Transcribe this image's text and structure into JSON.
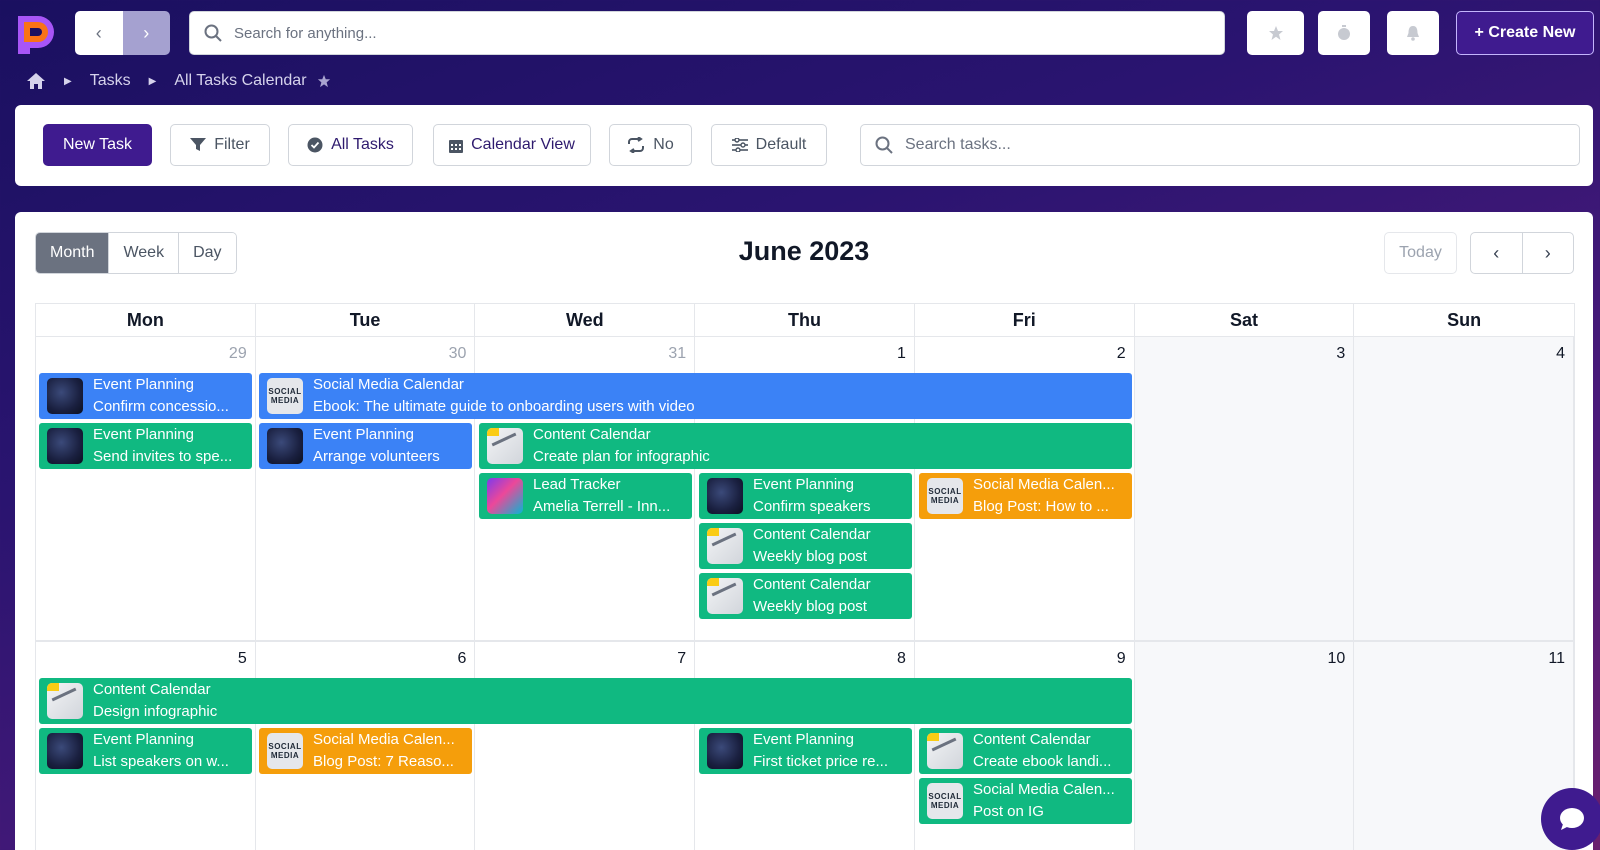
{
  "header": {
    "search_placeholder": "Search for anything...",
    "create_label": "+ Create New"
  },
  "breadcrumb": {
    "items": [
      "Tasks",
      "All Tasks Calendar"
    ]
  },
  "toolbar": {
    "new_task": "New Task",
    "filter": "Filter",
    "all_tasks": "All Tasks",
    "calendar_view": "Calendar View",
    "repeat": "No",
    "default": "Default",
    "search_placeholder": "Search tasks..."
  },
  "calendar": {
    "title": "June 2023",
    "views": [
      "Month",
      "Week",
      "Day"
    ],
    "active_view": "Month",
    "today_label": "Today",
    "weekdays": [
      "Mon",
      "Tue",
      "Wed",
      "Thu",
      "Fri",
      "Sat",
      "Sun"
    ],
    "weeks": [
      {
        "days": [
          "29",
          "30",
          "31",
          "1",
          "2",
          "3",
          "4"
        ],
        "muted": [
          true,
          true,
          true,
          false,
          false,
          false,
          false
        ]
      },
      {
        "days": [
          "5",
          "6",
          "7",
          "8",
          "9",
          "10",
          "11"
        ],
        "muted": [
          false,
          false,
          false,
          false,
          false,
          false,
          false
        ]
      }
    ],
    "events": [
      {
        "project": "Event Planning",
        "task": "Confirm concessio...",
        "color": "blue",
        "thumb": "space"
      },
      {
        "project": "Social Media Calendar",
        "task": "Ebook: The ultimate guide to onboarding users with video",
        "color": "blue",
        "thumb": "social"
      },
      {
        "project": "Event Planning",
        "task": "Send invites to spe...",
        "color": "green",
        "thumb": "space"
      },
      {
        "project": "Event Planning",
        "task": "Arrange volunteers",
        "color": "blue",
        "thumb": "space"
      },
      {
        "project": "Content Calendar",
        "task": "Create plan for infographic",
        "color": "green",
        "thumb": "content"
      },
      {
        "project": "Lead Tracker",
        "task": "Amelia Terrell - Inn...",
        "color": "green",
        "thumb": "lead"
      },
      {
        "project": "Event Planning",
        "task": "Confirm speakers",
        "color": "green",
        "thumb": "space"
      },
      {
        "project": "Social Media Calen...",
        "task": "Blog Post: How to ...",
        "color": "orange",
        "thumb": "social"
      },
      {
        "project": "Content Calendar",
        "task": "Weekly blog post",
        "color": "green",
        "thumb": "content"
      },
      {
        "project": "Content Calendar",
        "task": "Weekly blog post",
        "color": "green",
        "thumb": "content"
      },
      {
        "project": "Content Calendar",
        "task": "Design infographic",
        "color": "green",
        "thumb": "content"
      },
      {
        "project": "Event Planning",
        "task": "List speakers on w...",
        "color": "green",
        "thumb": "space"
      },
      {
        "project": "Social Media Calen...",
        "task": "Blog Post: 7 Reaso...",
        "color": "orange",
        "thumb": "social"
      },
      {
        "project": "Event Planning",
        "task": "First ticket price re...",
        "color": "green",
        "thumb": "space"
      },
      {
        "project": "Content Calendar",
        "task": "Create ebook landi...",
        "color": "green",
        "thumb": "content"
      },
      {
        "project": "Social Media Calen...",
        "task": "Post on IG",
        "color": "green",
        "thumb": "social"
      }
    ],
    "thumb_social_text": "SOCIAL MEDIA"
  },
  "colors": {
    "brand": "#3f1b8f",
    "event_blue": "#3b82f6",
    "event_green": "#10b981",
    "event_orange": "#f59e0b"
  }
}
